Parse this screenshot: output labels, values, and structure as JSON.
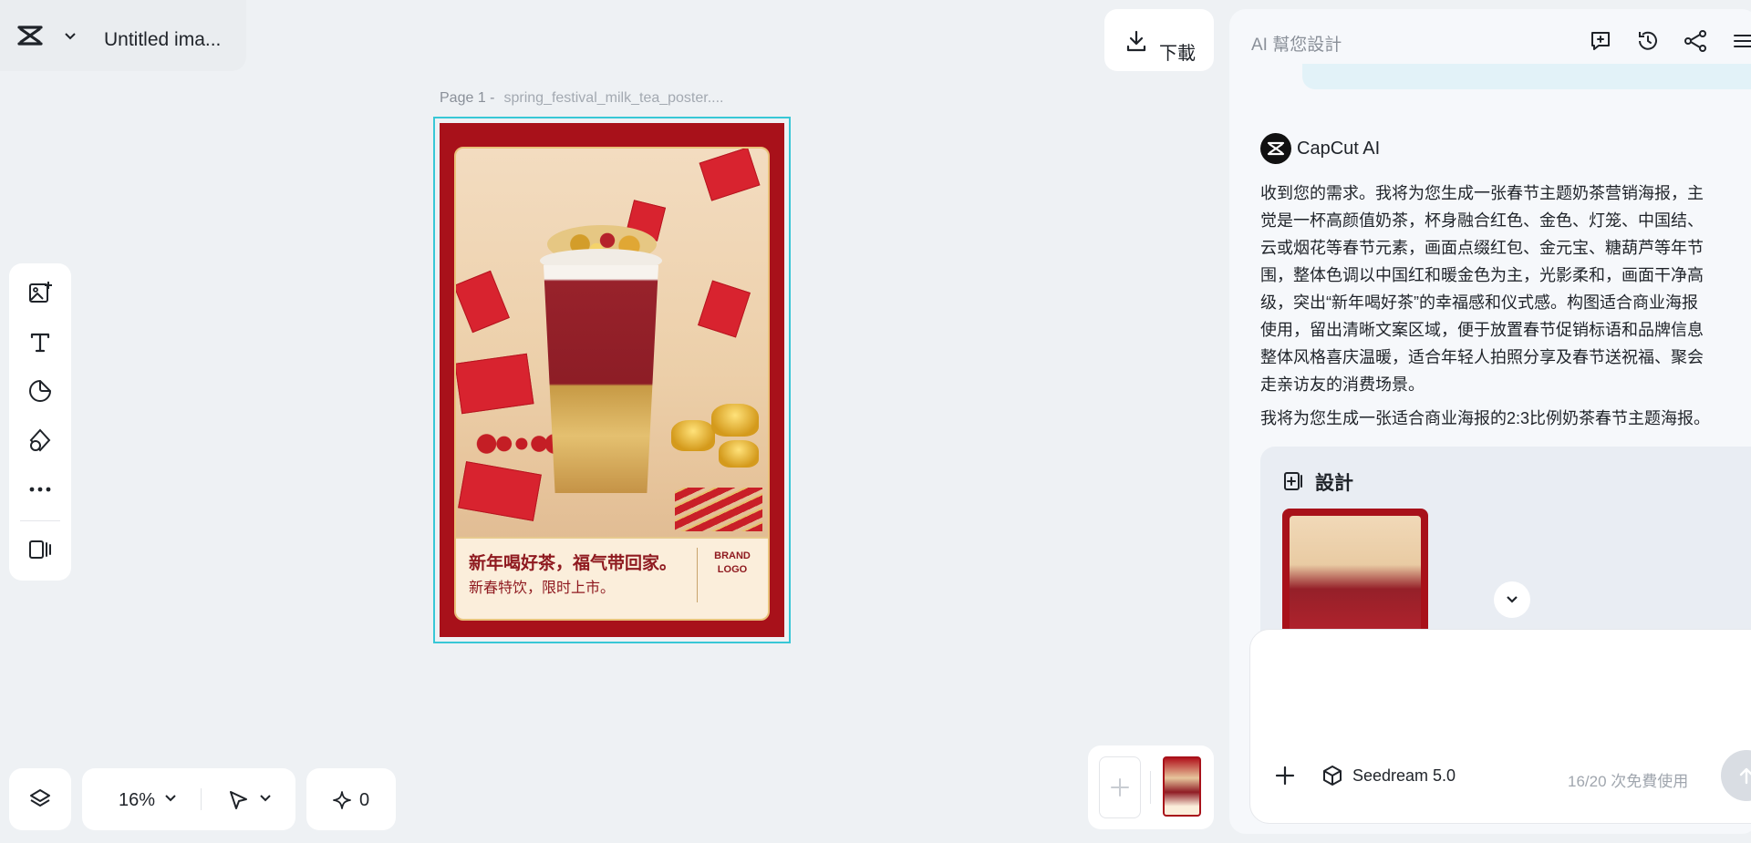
{
  "app": {
    "title": "Untitled ima...",
    "logo_icon": "capcut-logo-icon"
  },
  "download": {
    "label": "下載"
  },
  "canvas": {
    "page_label": "Page 1 -",
    "page_name": "spring_festival_milk_tea_poster....",
    "poster": {
      "headline": "新年喝好茶，福气带回家。",
      "subline": "新春特饮，限时上市。",
      "brand_line1": "BRAND",
      "brand_line2": "LOGO"
    }
  },
  "toolbar": {
    "tools": [
      "add-image-icon",
      "text-icon",
      "sticker-icon",
      "shapes-icon",
      "more-icon",
      "layout-icon"
    ]
  },
  "bottom": {
    "zoom": "16%",
    "credits": "0"
  },
  "panel": {
    "title": "AI 幫您設計",
    "ai_name": "CapCut AI",
    "message": "收到您的需求。我将为您生成一张春节主题奶茶营销海报，主\n觉是一杯高颜值奶茶，杯身融合红色、金色、灯笼、中国结、\n云或烟花等春节元素，画面点缀红包、金元宝、糖葫芦等年节\n围，整体色调以中国红和暖金色为主，光影柔和，画面干净高\n级，突出“新年喝好茶”的幸福感和仪式感。构图适合商业海报\n使用，留出清晰文案区域，便于放置春节促销标语和品牌信息\n整体风格喜庆温暖，适合年轻人拍照分享及春节送祝福、聚会\n走亲访友的消费场景。",
    "message2": "我将为您生成一张适合商业海报的2:3比例奶茶春节主题海报。",
    "design_title": "設計",
    "model": "Seedream 5.0",
    "quota": "16/20 次免費使用"
  },
  "colors": {
    "accent_selection": "#38c7d6",
    "poster_red": "#a8111a",
    "poster_text": "#8f1a20",
    "background": "#eef1f4"
  }
}
